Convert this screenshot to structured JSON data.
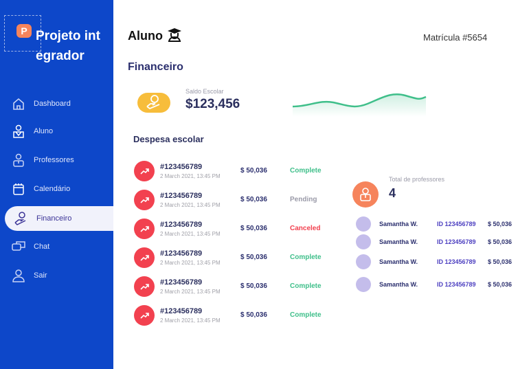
{
  "brand": {
    "logo_letter": "P",
    "name": "Projeto integrador"
  },
  "nav": [
    {
      "label": "Dashboard",
      "icon": "home-icon"
    },
    {
      "label": "Aluno",
      "icon": "student-icon"
    },
    {
      "label": "Professores",
      "icon": "teacher-icon"
    },
    {
      "label": "Calendário",
      "icon": "calendar-icon"
    },
    {
      "label": "Financeiro",
      "icon": "finance-icon",
      "active": true
    },
    {
      "label": "Chat",
      "icon": "chat-icon"
    },
    {
      "label": "Sair",
      "icon": "user-icon"
    }
  ],
  "header": {
    "title": "Aluno",
    "title_icon": "graduation-cap-icon",
    "matricula": "Matrícula #5654"
  },
  "finance": {
    "heading": "Financeiro",
    "balance_label": "Saldo Escolar",
    "balance": "$123,456"
  },
  "expenses": {
    "heading": "Despesa escolar",
    "rows": [
      {
        "id": "#123456789",
        "date": "2 March 2021, 13:45 PM",
        "amount": "$ 50,036",
        "status": "Complete"
      },
      {
        "id": "#123456789",
        "date": "2 March 2021, 13:45 PM",
        "amount": "$ 50,036",
        "status": "Pending"
      },
      {
        "id": "#123456789",
        "date": "2 March 2021, 13:45 PM",
        "amount": "$ 50,036",
        "status": "Canceled"
      },
      {
        "id": "#123456789",
        "date": "2 March 2021, 13:45 PM",
        "amount": "$ 50,036",
        "status": "Complete"
      },
      {
        "id": "#123456789",
        "date": "2 March 2021, 13:45 PM",
        "amount": "$ 50,036",
        "status": "Complete"
      },
      {
        "id": "#123456789",
        "date": "2 March 2021, 13:45 PM",
        "amount": "$ 50,036",
        "status": "Complete"
      }
    ]
  },
  "teachers": {
    "label": "Total de professores",
    "count": "4",
    "rows": [
      {
        "name": "Samantha W.",
        "id": "ID 123456789",
        "amount": "$ 50,036"
      },
      {
        "name": "Samantha W.",
        "id": "ID 123456789",
        "amount": "$ 50,036"
      },
      {
        "name": "Samantha W.",
        "id": "ID 123456789",
        "amount": "$ 50,036"
      },
      {
        "name": "Samantha W.",
        "id": "ID 123456789",
        "amount": "$ 50,036"
      }
    ]
  },
  "colors": {
    "sidebar": "#0d47c9",
    "complete": "#3fbf8a",
    "pending": "#9a9aa8",
    "canceled": "#f2414f"
  }
}
